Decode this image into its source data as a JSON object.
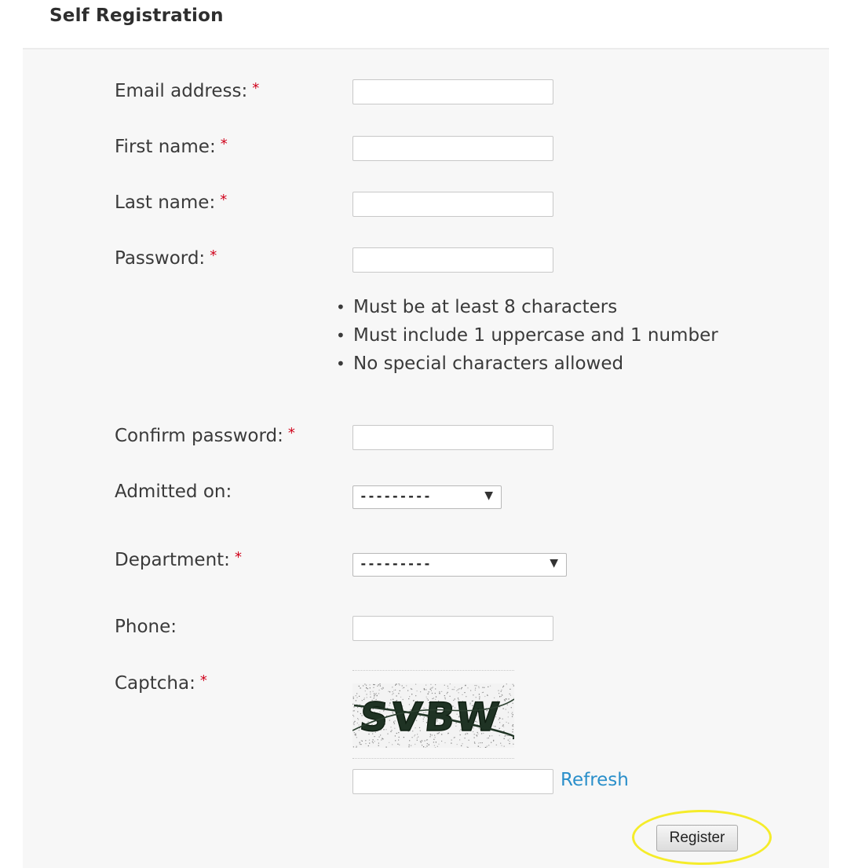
{
  "header": {
    "title": "Self Registration"
  },
  "form": {
    "required_marker": "*",
    "email": {
      "label": "Email address:",
      "value": ""
    },
    "first_name": {
      "label": "First name:",
      "value": ""
    },
    "last_name": {
      "label": "Last name:",
      "value": ""
    },
    "password": {
      "label": "Password:",
      "value": "",
      "rules": [
        "Must be at least 8 characters",
        "Must include 1 uppercase and 1 number",
        "No special characters allowed"
      ]
    },
    "confirm_password": {
      "label": "Confirm password:",
      "value": ""
    },
    "admitted_on": {
      "label": "Admitted on:",
      "selected": "---------"
    },
    "department": {
      "label": "Department:",
      "selected": "---------"
    },
    "phone": {
      "label": "Phone:",
      "value": ""
    },
    "captcha": {
      "label": "Captcha:",
      "image_text": "SVBW",
      "value": "",
      "refresh_label": "Refresh"
    },
    "register_label": "Register"
  },
  "annotation": {
    "highlight_color": "#f5ec2a"
  }
}
